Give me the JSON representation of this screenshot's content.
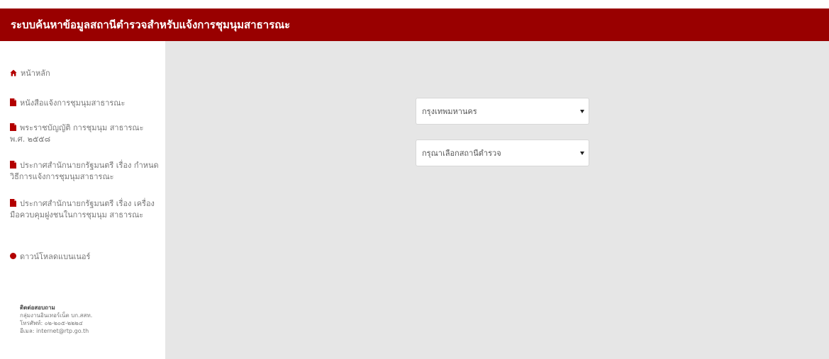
{
  "header": {
    "title": "ระบบค้นหาข้อมูลสถานีตำรวจสำหรับแจ้งการชุมนุมสาธารณะ",
    "background_color": "#990000"
  },
  "sidebar": {
    "items": [
      {
        "label": "หน้าหลัก",
        "icon": "home-icon"
      },
      {
        "label": "หนังสือแจ้งการชุมนุมสาธารณะ",
        "icon": "file-icon"
      },
      {
        "label": "พระราชบัญญัติ การชุมนุม สาธารณะ พ.ศ. ๒๕๕๘",
        "icon": "file-icon"
      },
      {
        "label": "ประกาศสำนักนายกรัฐมนตรี เรื่อง กำหนดวิธีการแจ้งการชุมนุมสาธารณะ",
        "icon": "file-icon"
      },
      {
        "label": "ประกาศสำนักนายกรัฐมนตรี เรื่อง เครื่องมือควบคุมฝูงชนในการชุมนุม สาธารณะ",
        "icon": "file-icon"
      },
      {
        "label": "ดาวน์โหลดแบนเนอร์",
        "icon": "dot-icon"
      }
    ],
    "icon_color": "#b30000"
  },
  "contact": {
    "title": "ติดต่อสอบถาม",
    "org": "กลุ่มงานอินเทอร์เน็ต บก.สสท.",
    "phone": "โทรศัพท์: ๐๒-๒๐๕-๒๒๒๔",
    "email": "อีเมล: internet@rtp.go.th"
  },
  "form": {
    "province_select": {
      "selected": "กรุงเทพมหานคร"
    },
    "station_select": {
      "selected": "กรุณาเลือกสถานีตำรวจ"
    }
  }
}
